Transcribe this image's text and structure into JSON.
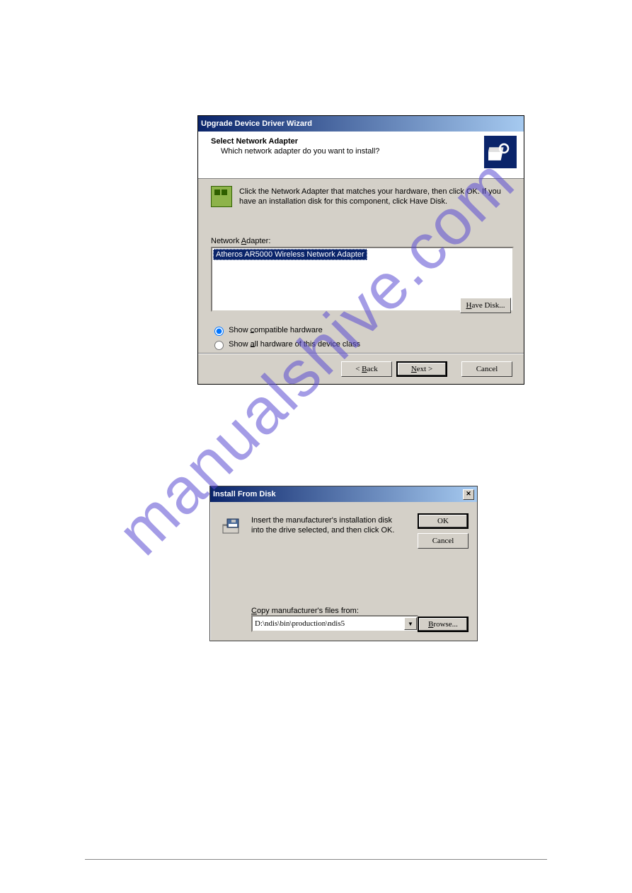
{
  "dialog1": {
    "title": "Upgrade Device Driver Wizard",
    "header_title": "Select Network Adapter",
    "header_sub": "Which network adapter do you want to install?",
    "instruction": "Click the Network Adapter that matches your hardware, then click OK. If you have an installation disk for this component, click Have Disk.",
    "list_label_pre": "Network ",
    "list_label_u": "A",
    "list_label_post": "dapter:",
    "list_item": "Atheros AR5000 Wireless Network Adapter",
    "radio_compat_pre": "Show ",
    "radio_compat_u": "c",
    "radio_compat_post": "ompatible hardware",
    "radio_all_pre": "Show ",
    "radio_all_u": "a",
    "radio_all_post": "ll hardware of this device class",
    "havedisk_u": "H",
    "havedisk_post": "ave Disk...",
    "back_lt": "< ",
    "back_u": "B",
    "back_post": "ack",
    "next_u": "N",
    "next_post": "ext >",
    "cancel": "Cancel"
  },
  "dialog2": {
    "title": "Install From Disk",
    "instruction": "Insert the manufacturer's installation disk into the drive selected, and then click OK.",
    "ok": "OK",
    "cancel": "Cancel",
    "files_label_u": "C",
    "files_label_post": "opy manufacturer's files from:",
    "path": "D:\\ndis\\bin\\production\\ndis5",
    "browse_u": "B",
    "browse_post": "rowse..."
  },
  "watermark": "manualshive.com"
}
